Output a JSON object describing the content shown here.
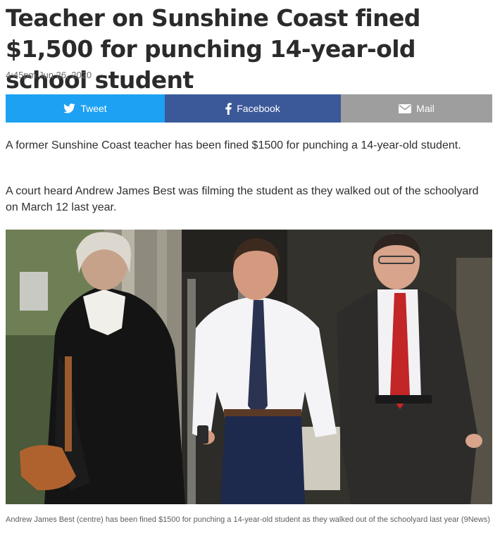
{
  "article": {
    "headline": "Teacher on Sunshine Coast fined $1,500 for punching 14-year-old school student",
    "timestamp": "4:45pm Jun 26, 2020",
    "share": {
      "tweet": {
        "label": "Tweet",
        "icon": "twitter-bird-icon",
        "color": "#1da1f2"
      },
      "facebook": {
        "label": "Facebook",
        "icon": "facebook-f-icon",
        "color": "#3b5998"
      },
      "mail": {
        "label": "Mail",
        "icon": "envelope-icon",
        "color": "#9e9e9e"
      }
    },
    "paragraphs": [
      "A former Sunshine Coast teacher has been fined $1500 for punching a 14-year-old student.",
      "A court heard Andrew James Best was filming the student as they walked out of the schoolyard on March 12 last year."
    ],
    "photo": {
      "caption": "Andrew James Best (centre) has been fined $1500 for punching a 14-year-old student as they walked out of the schoolyard last year (9News)"
    }
  }
}
